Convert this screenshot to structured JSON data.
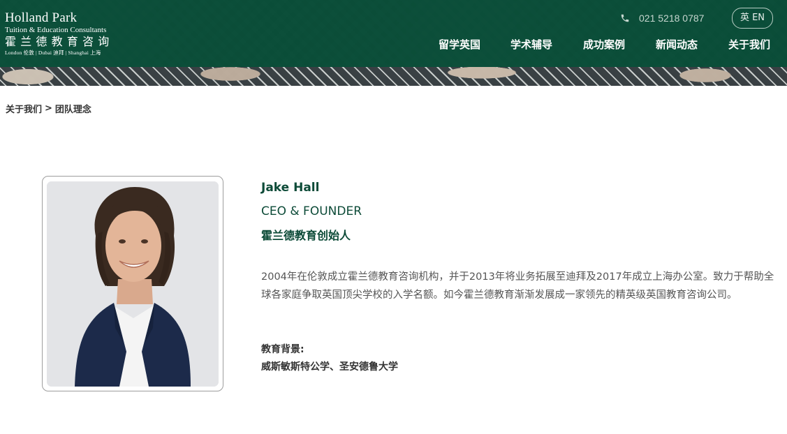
{
  "brand": {
    "name_en": "Holland Park",
    "subtitle_en": "Tuition & Education Consultants",
    "name_cn": "霍兰德教育咨询",
    "cities": "London 伦敦 | Dubai 迪拜 | Shanghai 上海"
  },
  "header": {
    "phone_icon": "phone-icon",
    "phone": "021 5218 0787",
    "language_button": "英 EN",
    "nav": [
      {
        "label": "留学英国"
      },
      {
        "label": "学术辅导"
      },
      {
        "label": "成功案例"
      },
      {
        "label": "新闻动态"
      },
      {
        "label": "关于我们"
      }
    ],
    "colors": {
      "brand_green": "#0f4b39",
      "text_green": "#0d4b38"
    }
  },
  "breadcrumb": {
    "parent": "关于我们",
    "separator": ">",
    "current": "团队理念"
  },
  "profile": {
    "name": "Jake Hall",
    "title_en": "CEO & FOUNDER",
    "title_cn": "霍兰德教育创始人",
    "bio": "2004年在伦敦成立霍兰德教育咨询机构，并于2013年将业务拓展至迪拜及2017年成立上海办公室。致力于帮助全球各家庭争取英国顶尖学校的入学名额。如今霍兰德教育渐渐发展成一家领先的精英级英国教育咨询公司。",
    "education_label": "教育背景:",
    "education_value": "威斯敏斯特公学、圣安德鲁大学"
  }
}
